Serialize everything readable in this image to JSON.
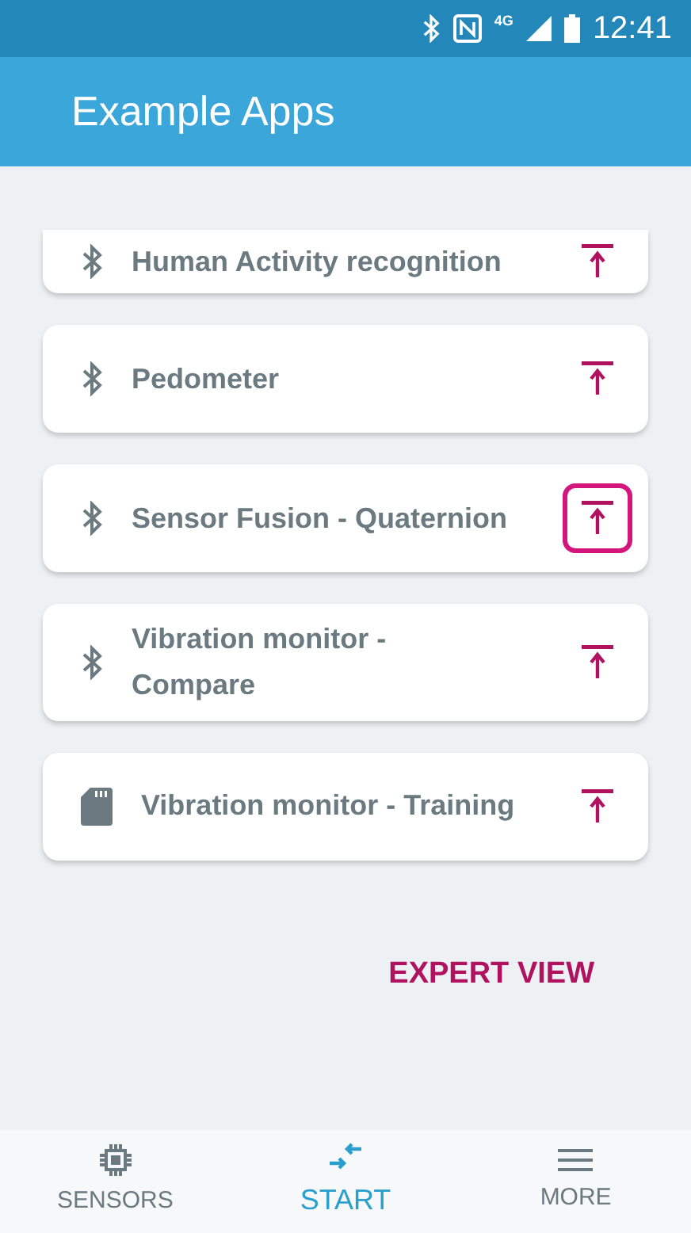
{
  "status_bar": {
    "time": "12:41",
    "network": "4G"
  },
  "app_bar": {
    "title": "Example Apps"
  },
  "apps": [
    {
      "name": "Human Activity recognition",
      "kind": "bluetooth",
      "highlighted": false,
      "partial": true
    },
    {
      "name": "Pedometer",
      "kind": "bluetooth",
      "highlighted": false,
      "partial": false
    },
    {
      "name": "Sensor Fusion - Quaternion",
      "kind": "bluetooth",
      "highlighted": true,
      "partial": false
    },
    {
      "name": "Vibration monitor -\nCompare",
      "kind": "bluetooth",
      "highlighted": false,
      "partial": false
    },
    {
      "name": "Vibration monitor - Training",
      "kind": "sdcard",
      "highlighted": false,
      "partial": false
    }
  ],
  "expert_view": "EXPERT VIEW",
  "bottom_nav": [
    {
      "label": "SENSORS",
      "kind": "chip",
      "selected": false
    },
    {
      "label": "START",
      "kind": "arrows",
      "selected": true
    },
    {
      "label": "MORE",
      "kind": "menu",
      "selected": false
    }
  ]
}
